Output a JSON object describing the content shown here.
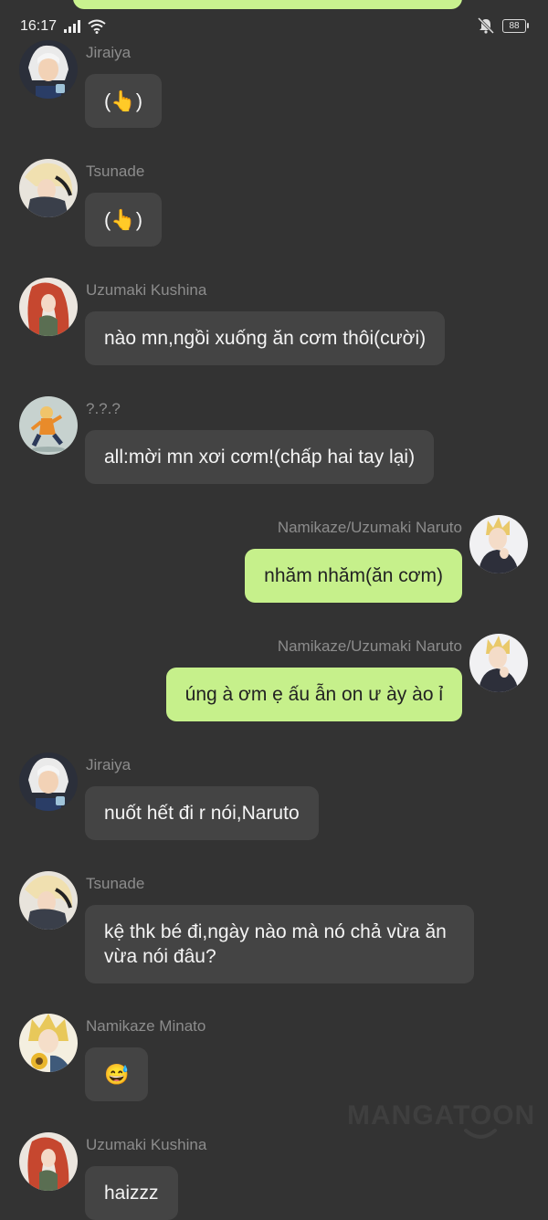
{
  "status_bar": {
    "time": "16:17",
    "battery": "88",
    "icons": [
      "signal-icon",
      "wifi-icon",
      "mute-icon",
      "battery-icon"
    ]
  },
  "messages": [
    {
      "sender": "Jiraiya",
      "text": "(👆)",
      "side": "left",
      "avatar": "avatar-jiraiya"
    },
    {
      "sender": "Tsunade",
      "text": "(👆)",
      "side": "left",
      "avatar": "avatar-tsunade"
    },
    {
      "sender": "Uzumaki Kushina",
      "text": "nào mn,ngồi xuống ăn cơm thôi(cười)",
      "side": "left",
      "avatar": "avatar-kushina"
    },
    {
      "sender": "?.?.?",
      "text": "all:mời mn xơi cơm!(chấp hai tay lại)",
      "side": "left",
      "avatar": "avatar-unknown"
    },
    {
      "sender": "Namikaze/Uzumaki Naruto",
      "text": "nhăm nhăm(ăn cơm)",
      "side": "right",
      "avatar": "avatar-naruto"
    },
    {
      "sender": "Namikaze/Uzumaki Naruto",
      "text": "úng à ơm ẹ ấu ẫn on ư ày ào ỉ",
      "side": "right",
      "avatar": "avatar-naruto"
    },
    {
      "sender": "Jiraiya",
      "text": "nuốt hết đi r nói,Naruto",
      "side": "left",
      "avatar": "avatar-jiraiya"
    },
    {
      "sender": "Tsunade",
      "text": "kệ thk bé đi,ngày nào mà nó chả vừa ăn vừa nói đâu?",
      "side": "left",
      "avatar": "avatar-tsunade"
    },
    {
      "sender": "Namikaze Minato",
      "text": "😅",
      "side": "left",
      "avatar": "avatar-minato"
    },
    {
      "sender": "Uzumaki Kushina",
      "text": "haizzz",
      "side": "left",
      "avatar": "avatar-kushina"
    }
  ],
  "watermark": "MANGATOON",
  "colors": {
    "background": "#333333",
    "incoming_bubble": "#444444",
    "outgoing_bubble": "#c6f08b",
    "sender_name": "#8c8c8c"
  }
}
